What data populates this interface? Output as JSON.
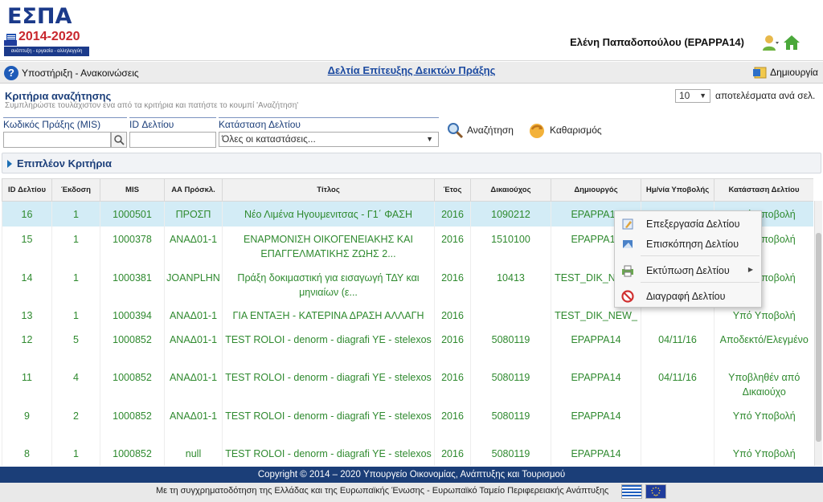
{
  "header": {
    "logo_title": "ΕΣΠΑ",
    "logo_years": "2014-2020",
    "logo_tagline": "ανάπτυξη - εργασία - αλληλεγγύη",
    "user_name": "Ελένη Παπαδοπούλου (EPAPPA14)"
  },
  "title_bar": {
    "support_link": "Υποστήριξη - Ανακοινώσεις",
    "page_title": "Δελτία Επίτευξης Δεικτών Πράξης",
    "create_label": "Δημιουργία"
  },
  "criteria": {
    "title": "Κριτήρια αναζήτησης",
    "subtitle": "Συμπληρώστε τουλάχιστον ένα από τα κριτήρια και πατήστε το κουμπί 'Αναζήτηση'",
    "results_per_page_value": "10",
    "results_per_page_label": "αποτελέσματα ανά σελ.",
    "mis_label": "Κωδικός Πράξης (MIS)",
    "mis_value": "",
    "id_label": "ID Δελτίου",
    "id_value": "",
    "status_label": "Κατάσταση Δελτίου",
    "status_value": "Όλες οι καταστάσεις...",
    "search_label": "Αναζήτηση",
    "clear_label": "Καθαρισμός",
    "extra_label": "Επιπλέον Κριτήρια"
  },
  "table": {
    "headers": [
      "ID Δελτίου",
      "Έκδοση",
      "MIS",
      "ΑΑ Πρόσκλ.",
      "Τίτλος",
      "Έτος",
      "Δικαιούχος",
      "Δημιουργός",
      "Ημ/νία Υποβολής",
      "Κατάσταση Δελτίου"
    ],
    "rows": [
      [
        "16",
        "1",
        "1000501",
        "ΠΡΟΣΠ",
        "Νέο Λιμένα Ηγουμενιτσας - Γ1΄ ΦΑΣΗ",
        "2016",
        "1090212",
        "EPAPPA14",
        "",
        "Υπό Υποβολή"
      ],
      [
        "15",
        "1",
        "1000378",
        "ΑΝΑΔ01-1",
        "ΕΝΑΡΜΟΝΙΣΗ ΟΙΚΟΓΕΝΕΙΑΚΗΣ ΚΑΙ ΕΠΑΓΓΕΛΜΑΤΙΚΗΣ ΖΩΗΣ 2...",
        "2016",
        "1510100",
        "EPAPPA14",
        "",
        "Υπό Υποβολή"
      ],
      [
        "14",
        "1",
        "1000381",
        "JOANPLHN",
        "Πράξη δοκιμαστική για εισαγωγή ΤΔΥ και μηνιαίων (ε...",
        "2016",
        "10413",
        "TEST_DIK_NEW_",
        "",
        "Υπό Υποβολή"
      ],
      [
        "13",
        "1",
        "1000394",
        "ΑΝΑΔ01-1",
        "ΓΙΑ ΕΝΤΑΞΗ - ΚΑΤΕΡΙΝΑ ΔΡΑΣΗ ΑΛΛΑΓΗ",
        "2016",
        "",
        "TEST_DIK_NEW_",
        "",
        "Υπό Υποβολή"
      ],
      [
        "12",
        "5",
        "1000852",
        "ΑΝΑΔ01-1",
        "TEST ROLOI - denorm - diagrafi YE - stelexos",
        "2016",
        "5080119",
        "EPAPPA14",
        "04/11/16",
        "Αποδεκτό/Ελεγμένο"
      ],
      [
        "11",
        "4",
        "1000852",
        "ΑΝΑΔ01-1",
        "TEST ROLOI - denorm - diagrafi YE - stelexos",
        "2016",
        "5080119",
        "EPAPPA14",
        "04/11/16",
        "Υποβληθέν από Δικαιούχο"
      ],
      [
        "9",
        "2",
        "1000852",
        "ΑΝΑΔ01-1",
        "TEST ROLOI - denorm - diagrafi YE - stelexos",
        "2016",
        "5080119",
        "EPAPPA14",
        "",
        "Υπό Υποβολή"
      ],
      [
        "8",
        "1",
        "1000852",
        "null",
        "TEST ROLOI - denorm - diagrafi YE - stelexos",
        "2016",
        "5080119",
        "EPAPPA14",
        "",
        "Υπό Υποβολή"
      ]
    ]
  },
  "context_menu": {
    "items": [
      {
        "label": "Επεξεργασία Δελτίου",
        "icon": "edit-icon"
      },
      {
        "label": "Επισκόπηση Δελτίου",
        "icon": "preview-icon"
      },
      {
        "label": "Εκτύπωση Δελτίου",
        "icon": "print-icon"
      },
      {
        "label": "Διαγραφή Δελτίου",
        "icon": "delete-icon"
      }
    ]
  },
  "footer": {
    "copyright": "Copyright © 2014 – 2020 Υπουργείο Οικονομίας, Ανάπτυξης και Τουρισμού",
    "cofunding": "Με τη συγχρηματοδότηση της Ελλάδας και της Ευρωπαϊκής Ένωσης - Ευρωπαϊκό Ταμείο Περιφερειακής Ανάπτυξης"
  },
  "colors": {
    "accent": "#1c4aa0",
    "row_text": "#2f8a2f",
    "selected_row": "#d3ecf6",
    "footer_bg": "#1b3e78"
  }
}
